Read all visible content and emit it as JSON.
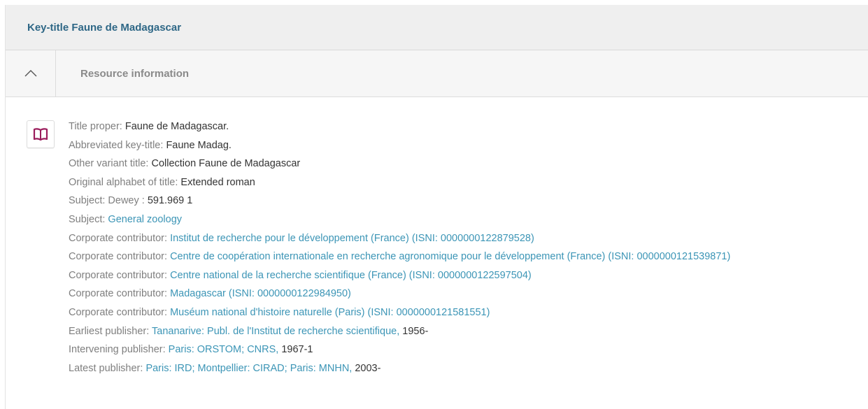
{
  "header": {
    "key_title": "Key-title Faune de Madagascar"
  },
  "section": {
    "label": "Resource information",
    "toggle_icon": "chevron-up-icon"
  },
  "record": {
    "icon": "book-icon",
    "rows": [
      {
        "label": "Title proper: ",
        "value": "Faune de Madagascar.",
        "link": ""
      },
      {
        "label": "Abbreviated key-title: ",
        "value": "Faune Madag.",
        "link": ""
      },
      {
        "label": "Other variant title: ",
        "value": "Collection Faune de Madagascar",
        "link": ""
      },
      {
        "label": "Original alphabet of title: ",
        "value": "Extended roman",
        "link": ""
      },
      {
        "label": "Subject: Dewey : ",
        "value": "591.969 1",
        "link": ""
      },
      {
        "label": "Subject: ",
        "value": "",
        "link": "General zoology"
      },
      {
        "label": "Corporate contributor: ",
        "value": "",
        "link": "Institut de recherche pour le développement (France) (ISNI: 0000000122879528)"
      },
      {
        "label": "Corporate contributor: ",
        "value": "",
        "link": "Centre de coopération internationale en recherche agronomique pour le développement (France) (ISNI: 0000000121539871)"
      },
      {
        "label": "Corporate contributor: ",
        "value": "",
        "link": "Centre national de la recherche scientifique (France) (ISNI: 0000000122597504)"
      },
      {
        "label": "Corporate contributor: ",
        "value": "",
        "link": "Madagascar (ISNI: 0000000122984950)"
      },
      {
        "label": "Corporate contributor: ",
        "value": "",
        "link": "Muséum national d'histoire naturelle (Paris) (ISNI: 0000000121581551)"
      },
      {
        "label": "Earliest publisher: ",
        "link": "Tananarive: Publ. de l'Institut de recherche scientifique,",
        "value": " 1956-"
      },
      {
        "label": "Intervening publisher: ",
        "link": "Paris: ORSTOM; CNRS,",
        "value": " 1967-1"
      },
      {
        "label": "Latest publisher: ",
        "link": "Paris: IRD; Montpellier: CIRAD; Paris: MNHN,",
        "value": " 2003-"
      }
    ]
  },
  "colors": {
    "key_title": "#2e6786",
    "link": "#3c95b6",
    "label": "#7f7f7f",
    "book_icon": "#9b1d5c"
  }
}
